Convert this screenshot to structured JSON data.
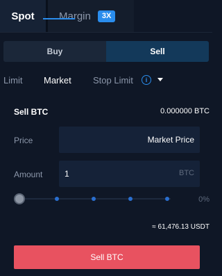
{
  "header": {
    "tabs": [
      {
        "label": "Spot",
        "active": true
      },
      {
        "label": "Margin",
        "active": false,
        "badge": "3X"
      }
    ]
  },
  "side_toggle": {
    "buy_label": "Buy",
    "sell_label": "Sell",
    "selected": "Sell"
  },
  "order_types": {
    "tabs": [
      {
        "label": "Limit",
        "active": false
      },
      {
        "label": "Market",
        "active": true
      },
      {
        "label": "Stop Limit",
        "active": false
      }
    ],
    "info_icon": "info-icon",
    "dropdown_icon": "caret-down-icon"
  },
  "form": {
    "title": "Sell BTC",
    "balance": "0.000000 BTC",
    "price_label": "Price",
    "price_value": "Market Price",
    "amount_label": "Amount",
    "amount_value": "1",
    "amount_unit": "BTC",
    "slider_percent": "0%",
    "estimate": "≈ 61,476.13 USDT",
    "submit_label": "Sell BTC"
  },
  "colors": {
    "accent": "#2a8ded",
    "sell": "#e85260",
    "background": "#0f1726"
  }
}
